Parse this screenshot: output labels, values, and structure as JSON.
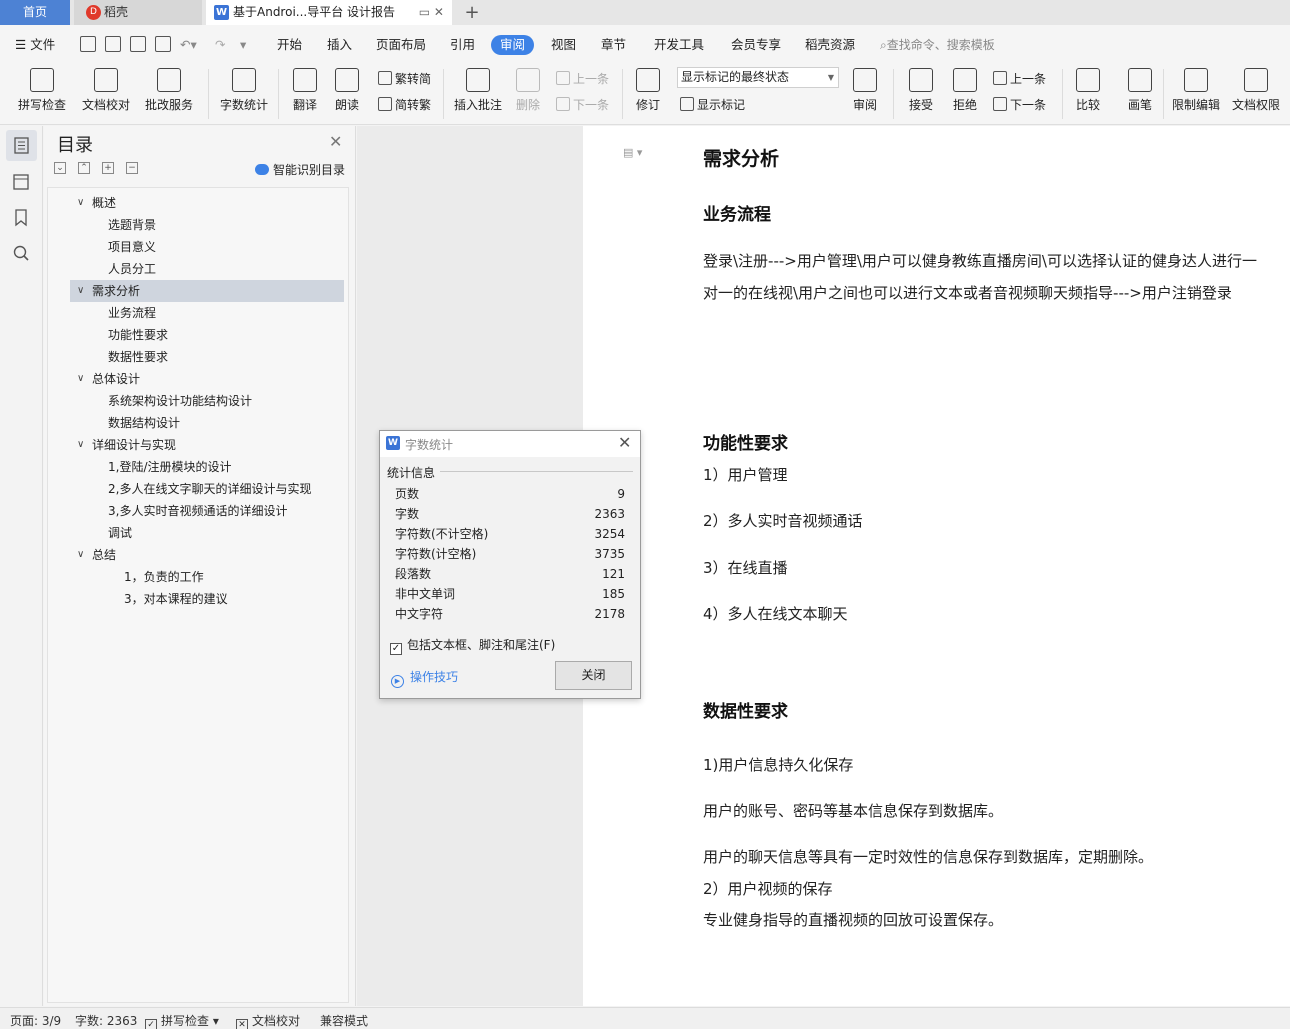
{
  "tabs": {
    "home": "首页",
    "daoke": "稻壳",
    "doc": "基于Androi...导平台 设计报告",
    "add": "+"
  },
  "menu": {
    "file": "文件",
    "items": [
      "开始",
      "插入",
      "页面布局",
      "引用",
      "审阅",
      "视图",
      "章节",
      "开发工具",
      "会员专享",
      "稻壳资源"
    ],
    "active": "审阅",
    "search": "查找命令、搜索模板"
  },
  "ribbon": {
    "spell_check": "拼写检查",
    "doc_proof": "文档校对",
    "revise_service": "批改服务",
    "word_count": "字数统计",
    "translate": "翻译",
    "read_aloud": "朗读",
    "trad_to_simp": "繁转简",
    "simp_to_trad": "简转繁",
    "insert_comment": "插入批注",
    "delete": "删除",
    "prev_comment": "上一条",
    "next_comment": "下一条",
    "revise": "修订",
    "markup_select": "显示标记的最终状态",
    "show_markup": "显示标记",
    "review": "审阅",
    "accept": "接受",
    "reject": "拒绝",
    "prev_change": "上一条",
    "next_change": "下一条",
    "compare": "比较",
    "pen": "画笔",
    "restrict_edit": "限制编辑",
    "doc_permission": "文档权限"
  },
  "toc": {
    "title": "目录",
    "smart": "智能识别目录",
    "items": [
      {
        "label": "概述",
        "level": 1,
        "expanded": true
      },
      {
        "label": "选题背景",
        "level": 2
      },
      {
        "label": "项目意义",
        "level": 2
      },
      {
        "label": "人员分工",
        "level": 2
      },
      {
        "label": "需求分析",
        "level": 1,
        "expanded": true,
        "selected": true
      },
      {
        "label": "业务流程",
        "level": 2
      },
      {
        "label": "功能性要求",
        "level": 2
      },
      {
        "label": "数据性要求",
        "level": 2
      },
      {
        "label": "总体设计",
        "level": 1,
        "expanded": true
      },
      {
        "label": "系统架构设计功能结构设计",
        "level": 2
      },
      {
        "label": "数据结构设计",
        "level": 2
      },
      {
        "label": "详细设计与实现",
        "level": 1,
        "expanded": true
      },
      {
        "label": "1,登陆/注册模块的设计",
        "level": 2
      },
      {
        "label": "2,多人在线文字聊天的详细设计与实现",
        "level": 2
      },
      {
        "label": "3,多人实时音视频通话的详细设计",
        "level": 2
      },
      {
        "label": "调试",
        "level": 2
      },
      {
        "label": "总结",
        "level": 1,
        "expanded": true
      },
      {
        "label": "1，负责的工作",
        "level": 3
      },
      {
        "label": "3，对本课程的建议",
        "level": 3
      }
    ]
  },
  "document": {
    "h1": "需求分析",
    "s1_title": "业务流程",
    "s1_body": "登录\\注册--->用户管理\\用户可以健身教练直播房间\\可以选择认证的健身达人进行一对一的在线视\\用户之间也可以进行文本或者音视频聊天频指导--->用户注销登录",
    "s2_title": "功能性要求",
    "s2_items": [
      "1）用户管理",
      "2）多人实时音视频通话",
      "3）在线直播",
      "4）多人在线文本聊天"
    ],
    "s3_title": "数据性要求",
    "s3_p1": "1)用户信息持久化保存",
    "s3_p2": "用户的账号、密码等基本信息保存到数据库。",
    "s3_p3": "用户的聊天信息等具有一定时效性的信息保存到数据库，定期删除。",
    "s3_p4": "2）用户视频的保存",
    "s3_p5": "专业健身指导的直播视频的回放可设置保存。"
  },
  "dialog": {
    "title": "字数统计",
    "section": "统计信息",
    "stats": [
      {
        "label": "页数",
        "value": "9"
      },
      {
        "label": "字数",
        "value": "2363"
      },
      {
        "label": "字符数(不计空格)",
        "value": "3254"
      },
      {
        "label": "字符数(计空格)",
        "value": "3735"
      },
      {
        "label": "段落数",
        "value": "121"
      },
      {
        "label": "非中文单词",
        "value": "185"
      },
      {
        "label": "中文字符",
        "value": "2178"
      }
    ],
    "checkbox": "包括文本框、脚注和尾注(F)",
    "checked": true,
    "tips": "操作技巧",
    "close": "关闭"
  },
  "status": {
    "page": "页面: 3/9",
    "words": "字数: 2363",
    "spell": "拼写检查",
    "proof": "文档校对",
    "compat": "兼容模式"
  }
}
